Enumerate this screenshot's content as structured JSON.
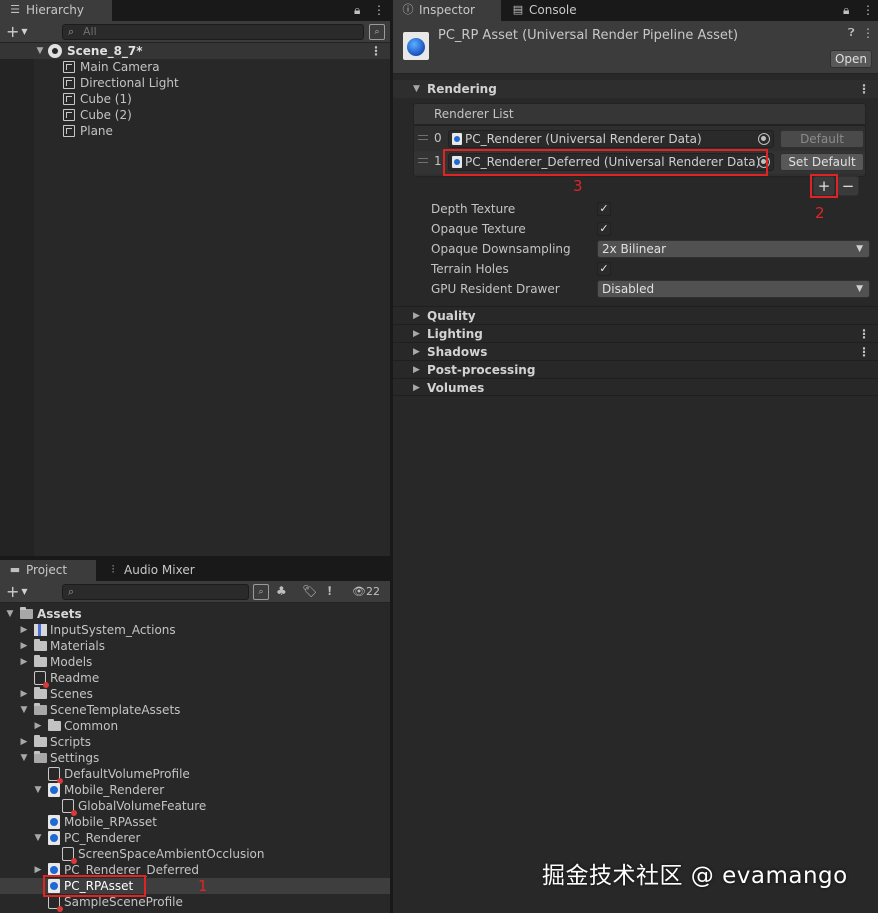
{
  "hierarchy": {
    "tab_label": "Hierarchy",
    "search_placeholder": "All",
    "scene_name": "Scene_8_7*",
    "items": [
      "Main Camera",
      "Directional Light",
      "Cube (1)",
      "Cube (2)",
      "Plane"
    ]
  },
  "project": {
    "tabs": [
      "Project",
      "Audio Mixer"
    ],
    "hidden_count": "22",
    "tree": [
      {
        "label": "Assets",
        "icon": "folder-open-icon",
        "depth": 0,
        "expanded": true
      },
      {
        "label": "InputSystem_Actions",
        "icon": "input-actions-icon",
        "depth": 1,
        "collapsed": true
      },
      {
        "label": "Materials",
        "icon": "folder-icon",
        "depth": 1,
        "collapsed": true
      },
      {
        "label": "Models",
        "icon": "folder-icon",
        "depth": 1,
        "collapsed": true
      },
      {
        "label": "Readme",
        "icon": "config-asset-icon",
        "depth": 1
      },
      {
        "label": "Scenes",
        "icon": "folder-icon",
        "depth": 1,
        "collapsed": true
      },
      {
        "label": "SceneTemplateAssets",
        "icon": "folder-open-icon",
        "depth": 1,
        "expanded": true
      },
      {
        "label": "Common",
        "icon": "folder-icon",
        "depth": 2,
        "collapsed": true
      },
      {
        "label": "Scripts",
        "icon": "folder-icon",
        "depth": 1,
        "collapsed": true
      },
      {
        "label": "Settings",
        "icon": "folder-open-icon",
        "depth": 1,
        "expanded": true
      },
      {
        "label": "DefaultVolumeProfile",
        "icon": "config-asset-icon",
        "depth": 2
      },
      {
        "label": "Mobile_Renderer",
        "icon": "render-asset-icon",
        "depth": 2,
        "expanded": true
      },
      {
        "label": "GlobalVolumeFeature",
        "icon": "config-asset-icon",
        "depth": 3
      },
      {
        "label": "Mobile_RPAsset",
        "icon": "render-asset-icon",
        "depth": 2
      },
      {
        "label": "PC_Renderer",
        "icon": "render-asset-icon",
        "depth": 2,
        "expanded": true
      },
      {
        "label": "ScreenSpaceAmbientOcclusion",
        "icon": "config-asset-icon",
        "depth": 3
      },
      {
        "label": "PC_Renderer_Deferred",
        "icon": "render-asset-icon",
        "depth": 2,
        "collapsed": true
      },
      {
        "label": "PC_RPAsset",
        "icon": "render-asset-icon",
        "depth": 2,
        "selected": true
      },
      {
        "label": "SampleSceneProfile",
        "icon": "config-asset-icon",
        "depth": 2
      }
    ]
  },
  "inspector": {
    "tabs": [
      "Inspector",
      "Console"
    ],
    "asset_title": "PC_RP Asset (Universal Render Pipeline Asset)",
    "open_button": "Open",
    "rendering_section": "Rendering",
    "renderer_list_label": "Renderer List",
    "renderers": [
      {
        "index": "0",
        "value": "PC_Renderer (Universal Renderer Data)",
        "button": "Default"
      },
      {
        "index": "1",
        "value": "PC_Renderer_Deferred (Universal Renderer Data)",
        "button": "Set Default"
      }
    ],
    "add_button": "+",
    "remove_button": "−",
    "properties": [
      {
        "label": "Depth Texture",
        "type": "checkbox",
        "checked": true
      },
      {
        "label": "Opaque Texture",
        "type": "checkbox",
        "checked": true
      },
      {
        "label": "Opaque Downsampling",
        "type": "dropdown",
        "value": "2x Bilinear"
      },
      {
        "label": "Terrain Holes",
        "type": "checkbox",
        "checked": true
      },
      {
        "label": "GPU Resident Drawer",
        "type": "dropdown",
        "value": "Disabled"
      }
    ],
    "sections": [
      "Quality",
      "Lighting",
      "Shadows",
      "Post-processing",
      "Volumes"
    ]
  },
  "annotations": {
    "step1": "1",
    "step2": "2",
    "step3": "3",
    "color": "#e02424"
  },
  "watermark": "掘金技术社区 @ evamango"
}
